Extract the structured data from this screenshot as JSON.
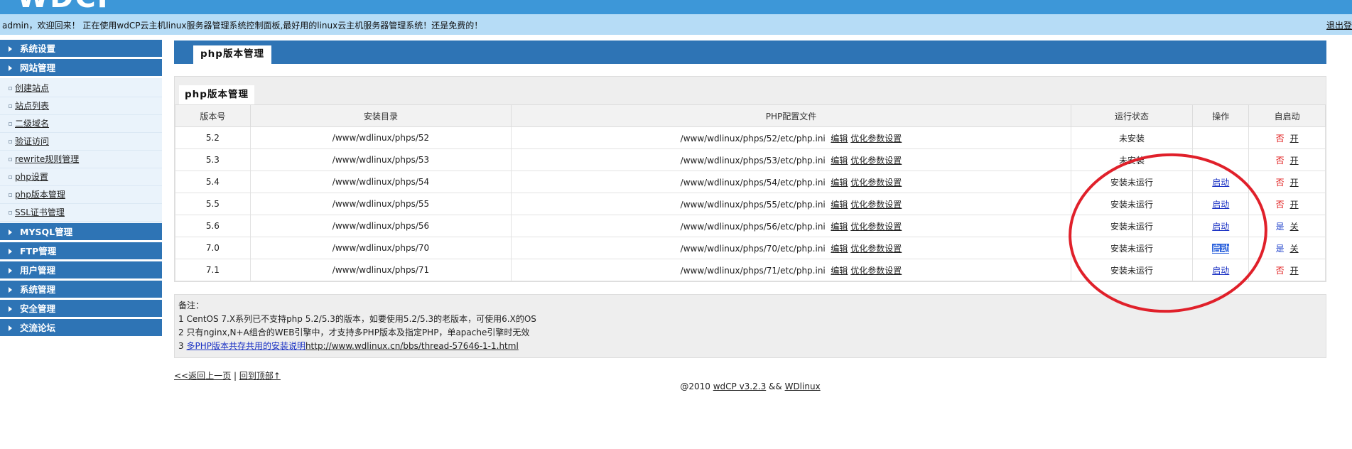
{
  "header": {
    "logo": "WDCP",
    "welcome": "admin，欢迎回来！ 正在使用wdCP云主机linux服务器管理系统控制面板,最好用的linux云主机服务器管理系统！还是免费的！",
    "logout": "退出登"
  },
  "sidebar": {
    "groups": [
      {
        "label": "系统设置"
      },
      {
        "label": "网站管理",
        "items": [
          "创建站点",
          "站点列表",
          "二级域名",
          "验证访问",
          "rewrite规则管理",
          "php设置",
          "php版本管理",
          "SSL证书管理"
        ]
      },
      {
        "label": "MYSQL管理"
      },
      {
        "label": "FTP管理"
      },
      {
        "label": "用户管理"
      },
      {
        "label": "系统管理"
      },
      {
        "label": "安全管理"
      },
      {
        "label": "交流论坛"
      }
    ]
  },
  "main": {
    "title": "php版本管理",
    "panel_title": "php版本管理",
    "columns": [
      "版本号",
      "安装目录",
      "PHP配置文件",
      "运行状态",
      "操作",
      "自启动"
    ],
    "edit_label": "编辑",
    "optimize_label": "优化参数设置",
    "rows": [
      {
        "version": "5.2",
        "dir": "/www/wdlinux/phps/52",
        "config": "/www/wdlinux/phps/52/etc/php.ini",
        "status": "未安装",
        "action": "",
        "autostart": "否",
        "toggle": "开"
      },
      {
        "version": "5.3",
        "dir": "/www/wdlinux/phps/53",
        "config": "/www/wdlinux/phps/53/etc/php.ini",
        "status": "未安装",
        "action": "",
        "autostart": "否",
        "toggle": "开"
      },
      {
        "version": "5.4",
        "dir": "/www/wdlinux/phps/54",
        "config": "/www/wdlinux/phps/54/etc/php.ini",
        "status": "安装未运行",
        "action": "启动",
        "autostart": "否",
        "toggle": "开"
      },
      {
        "version": "5.5",
        "dir": "/www/wdlinux/phps/55",
        "config": "/www/wdlinux/phps/55/etc/php.ini",
        "status": "安装未运行",
        "action": "启动",
        "autostart": "否",
        "toggle": "开"
      },
      {
        "version": "5.6",
        "dir": "/www/wdlinux/phps/56",
        "config": "/www/wdlinux/phps/56/etc/php.ini",
        "status": "安装未运行",
        "action": "启动",
        "autostart": "是",
        "toggle": "关"
      },
      {
        "version": "7.0",
        "dir": "/www/wdlinux/phps/70",
        "config": "/www/wdlinux/phps/70/etc/php.ini",
        "status": "安装未运行",
        "action": "启动",
        "autostart": "是",
        "toggle": "关"
      },
      {
        "version": "7.1",
        "dir": "/www/wdlinux/phps/71",
        "config": "/www/wdlinux/phps/71/etc/php.ini",
        "status": "安装未运行",
        "action": "启动",
        "autostart": "否",
        "toggle": "开"
      }
    ],
    "notes": {
      "heading": "备注：",
      "line1": "1 CentOS 7.X系列已不支持php 5.2/5.3的版本，如要使用5.2/5.3的老版本，可使用6.X的OS",
      "line2": "2 只有nginx,N+A组合的WEB引擎中，才支持多PHP版本及指定PHP，单apache引擎时无效",
      "line3_prefix": "3 ",
      "line3_link": "多PHP版本共存共用的安装说明",
      "line3_url": "http://www.wdlinux.cn/bbs/thread-57646-1-1.html"
    },
    "back_label": "<<返回上一页",
    "separator": "|",
    "top_label": "回到顶部↑"
  },
  "footer": {
    "copyright": "@2010",
    "version": "wdCP v3.2.3",
    "amp": "&&",
    "brand": "WDlinux"
  },
  "colors": {
    "header_blue": "#3d97d8",
    "welcome_bg": "#b6dcf6",
    "menu_blue": "#2e74b5",
    "status_red": "#e01818",
    "link_blue": "#1a31c4"
  }
}
